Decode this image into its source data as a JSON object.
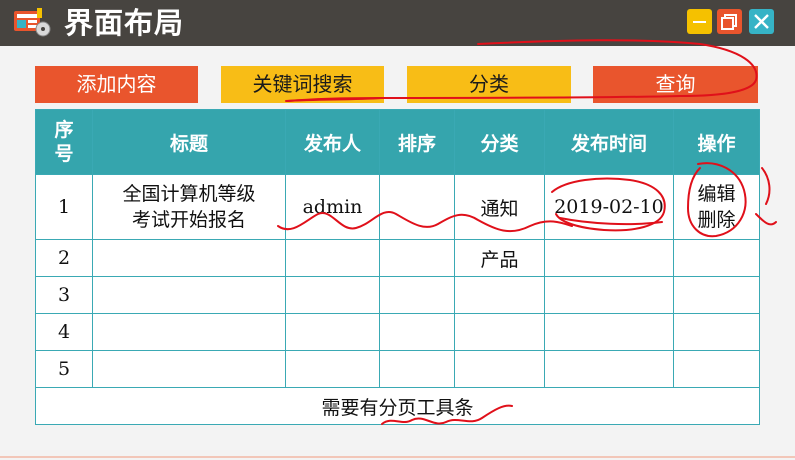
{
  "titlebar": {
    "title": "界面布局",
    "logo_icon": "app-logo-icon",
    "minimize_icon": "minimize-icon",
    "maximize_icon": "maximize-icon",
    "close_icon": "close-icon",
    "colors": {
      "bar": "#474440",
      "minimize": "#f5c100",
      "maximize": "#e9552d",
      "close": "#36b3c6"
    }
  },
  "toolbar": {
    "add_label": "添加内容",
    "keyword_search_label": "关键词搜索",
    "category_label": "分类",
    "query_label": "查询",
    "colors": {
      "primary": "#e9552d",
      "secondary": "#f8bd16"
    }
  },
  "table": {
    "headers": [
      "序号",
      "标题",
      "发布人",
      "排序",
      "分类",
      "发布时间",
      "操作"
    ],
    "header_color": "#35a5ad",
    "rows": [
      {
        "index": "1",
        "title_line1": "全国计算机等级",
        "title_line2": "考试开始报名",
        "publisher": "admin",
        "sort": "",
        "category": "通知",
        "time": "2019-02-10",
        "action_edit": "编辑",
        "action_delete": "删除"
      },
      {
        "index": "2",
        "title": "",
        "publisher": "",
        "sort": "",
        "category": "产品",
        "time": "",
        "actions": ""
      },
      {
        "index": "3",
        "title": "",
        "publisher": "",
        "sort": "",
        "category": "",
        "time": "",
        "actions": ""
      },
      {
        "index": "4",
        "title": "",
        "publisher": "",
        "sort": "",
        "category": "",
        "time": "",
        "actions": ""
      },
      {
        "index": "5",
        "title": "",
        "publisher": "",
        "sort": "",
        "category": "",
        "time": "",
        "actions": ""
      }
    ],
    "footer_note": "需要有分页工具条"
  },
  "annotation_color": "#e0101a"
}
